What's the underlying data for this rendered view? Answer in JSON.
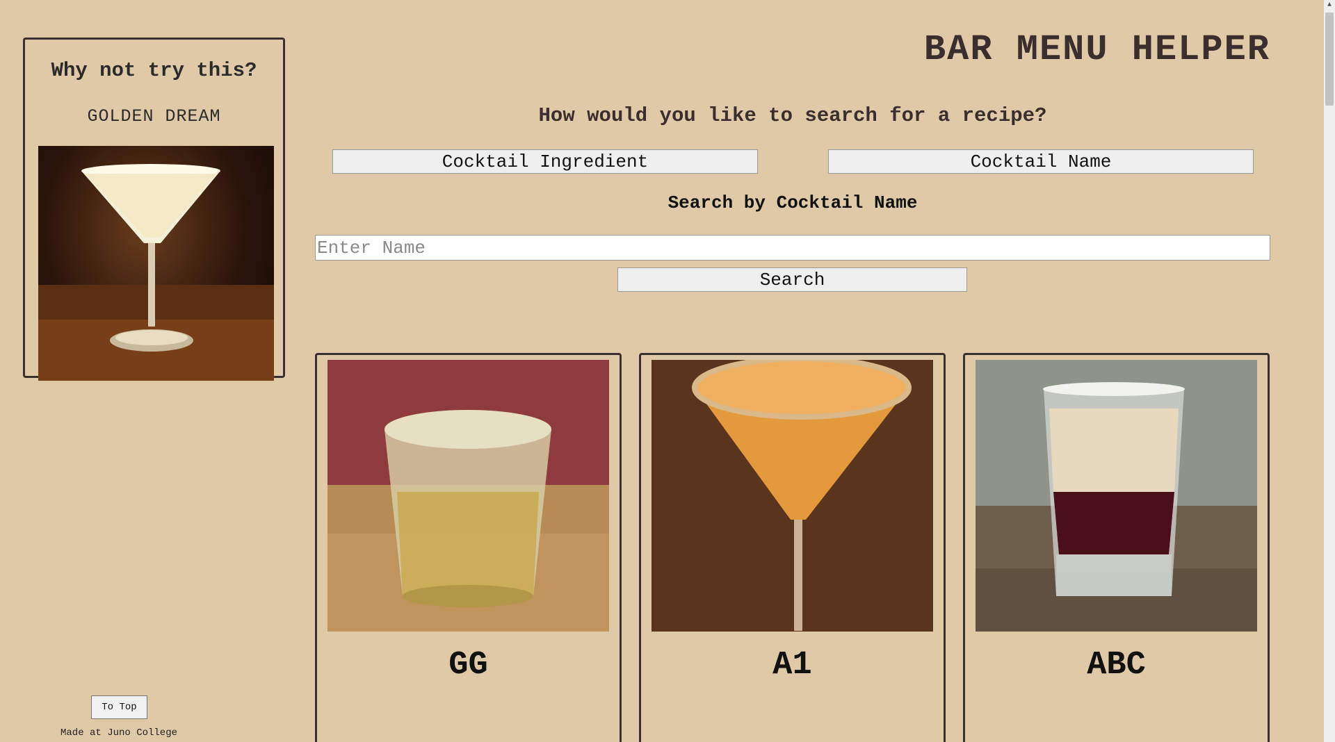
{
  "header": {
    "title": "BAR MENU HELPER",
    "prompt": "How would you like to search for a recipe?"
  },
  "modes": {
    "ingredient_label": "Cocktail Ingredient",
    "name_label": "Cocktail Name"
  },
  "search": {
    "heading": "Search by Cocktail Name",
    "placeholder": "Enter Name",
    "value": "",
    "button_label": "Search"
  },
  "suggestion": {
    "title": "Why not try this?",
    "name": "GOLDEN DREAM"
  },
  "results": [
    {
      "name": "GG"
    },
    {
      "name": "A1"
    },
    {
      "name": "ABC"
    }
  ],
  "footer": {
    "to_top_label": "To Top",
    "note": "Made at Juno College"
  },
  "colors": {
    "background": "#e0c9a6",
    "border": "#3a3030",
    "title": "#3a2e2e"
  }
}
